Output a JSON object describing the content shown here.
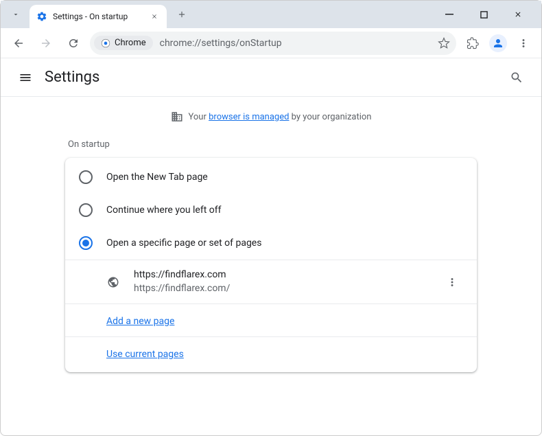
{
  "tab": {
    "title": "Settings - On startup"
  },
  "omnibox": {
    "chip_label": "Chrome",
    "url": "chrome://settings/onStartup"
  },
  "header": {
    "title": "Settings"
  },
  "managed": {
    "prefix": "Your ",
    "link": "browser is managed",
    "suffix": " by your organization"
  },
  "startup": {
    "section_title": "On startup",
    "options": [
      {
        "label": "Open the New Tab page"
      },
      {
        "label": "Continue where you left off"
      },
      {
        "label": "Open a specific page or set of pages"
      }
    ],
    "pages": [
      {
        "title": "https://findflarex.com",
        "url": "https://findflarex.com/"
      }
    ],
    "add_page_label": "Add a new page",
    "use_current_label": "Use current pages"
  }
}
